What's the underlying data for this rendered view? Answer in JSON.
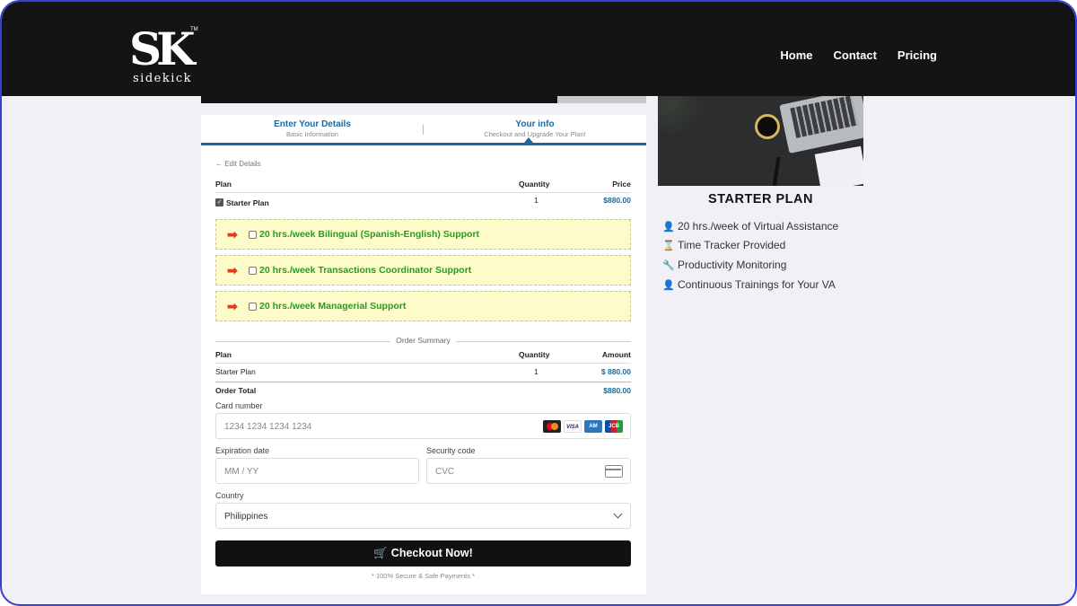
{
  "brand": {
    "logo_mark": "SK",
    "logo_word": "sidekick",
    "trademark": "TM"
  },
  "nav": {
    "home": "Home",
    "contact": "Contact",
    "pricing": "Pricing"
  },
  "steps": [
    {
      "title": "Enter Your Details",
      "subtitle": "Basic Information"
    },
    {
      "title": "Your info",
      "subtitle": "Checkout and Upgrade Your Plan!"
    }
  ],
  "edit_details": "← Edit Details",
  "plan_table": {
    "headers": {
      "plan": "Plan",
      "quantity": "Quantity",
      "price": "Price"
    },
    "row": {
      "name": "Starter Plan",
      "qty": "1",
      "price": "$880.00",
      "checked": true
    }
  },
  "addons": [
    {
      "label": "20 hrs./week Bilingual (Spanish-English) Support",
      "checked": false
    },
    {
      "label": "20 hrs./week Transactions Coordinator Support",
      "checked": false
    },
    {
      "label": "20 hrs./week Managerial Support",
      "checked": false
    }
  ],
  "order_summary": {
    "title": "Order Summary",
    "headers": {
      "plan": "Plan",
      "quantity": "Quantity",
      "amount": "Amount"
    },
    "row": {
      "name": "Starter Plan",
      "qty": "1",
      "amount": "$ 880.00"
    },
    "total_label": "Order Total",
    "total_value": "$880.00"
  },
  "payment": {
    "card_number_label": "Card number",
    "card_number_placeholder": "1234 1234 1234 1234",
    "card_brands": [
      "mastercard",
      "VISA",
      "amex",
      "JCB"
    ],
    "expiration_label": "Expiration date",
    "expiration_placeholder": "MM / YY",
    "security_label": "Security code",
    "security_placeholder": "CVC",
    "country_label": "Country",
    "country_value": "Philippines"
  },
  "checkout_button": "Checkout Now!",
  "secure_note": "* 100% Secure & Safe Payments *",
  "plan_panel": {
    "title": "STARTER PLAN",
    "features": [
      {
        "icon": "user-cog-icon",
        "text": "20 hrs./week of Virtual Assistance"
      },
      {
        "icon": "hourglass-icon",
        "text": "Time Tracker Provided"
      },
      {
        "icon": "wrench-icon",
        "text": "Productivity Monitoring"
      },
      {
        "icon": "user-cog-icon",
        "text": "Continuous Trainings for Your VA"
      }
    ]
  },
  "colors": {
    "accent": "#1a6aa0",
    "addon_bg": "#fdfbc8",
    "addon_text": "#21a021",
    "arrow": "#e13b1d",
    "header": "#141414"
  }
}
